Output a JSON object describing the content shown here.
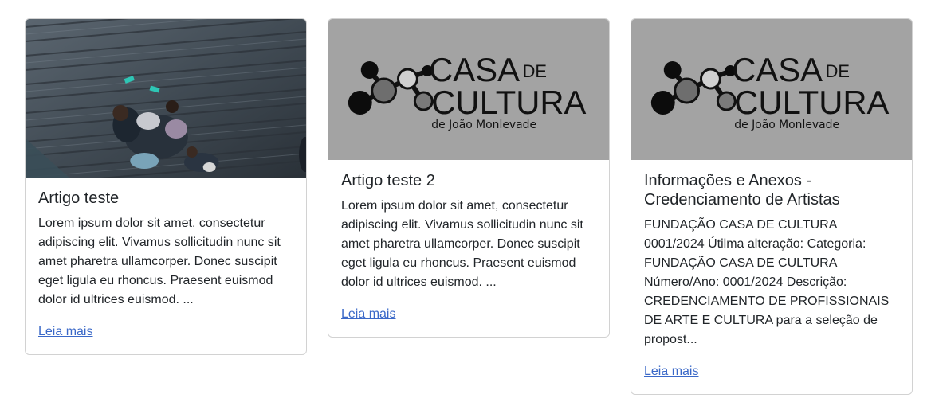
{
  "theme": {
    "link_color": "#3a68c8",
    "logo_bg": "#a3a3a3"
  },
  "cards": [
    {
      "image": "photo of people sitting on a wooden boardwalk (aerial view)",
      "title": "Artigo teste",
      "text": "Lorem ipsum dolor sit amet, consectetur adipiscing elit. Vivamus sollicitudin nunc sit amet pharetra ullamcorper. Donec suscipit eget ligula eu rhoncus. Praesent euismod dolor id ultrices euismod. ...",
      "link": "Leia mais"
    },
    {
      "image": "casa-de-cultura-logo",
      "logo": {
        "line1": "CASA",
        "de": "DE",
        "line2": "CULTURA",
        "line3": "de João Monlevade"
      },
      "title": "Artigo teste 2",
      "text": "Lorem ipsum dolor sit amet, consectetur adipiscing elit. Vivamus sollicitudin nunc sit amet pharetra ullamcorper. Donec suscipit eget ligula eu rhoncus. Praesent euismod dolor id ultrices euismod. ...",
      "link": "Leia mais"
    },
    {
      "image": "casa-de-cultura-logo",
      "logo": {
        "line1": "CASA",
        "de": "DE",
        "line2": "CULTURA",
        "line3": "de João Monlevade"
      },
      "title": "Informações e Anexos - Credenciamento de Artistas",
      "text": "FUNDAÇÃO CASA DE CULTURA 0001/2024 Útilma alteração: Categoria: FUNDAÇÃO CASA DE CULTURA Número/Ano: 0001/2024 Descrição: CREDENCIAMENTO DE PROFISSIONAIS DE ARTE E CULTURA para a seleção de propost...",
      "link": "Leia mais"
    }
  ]
}
